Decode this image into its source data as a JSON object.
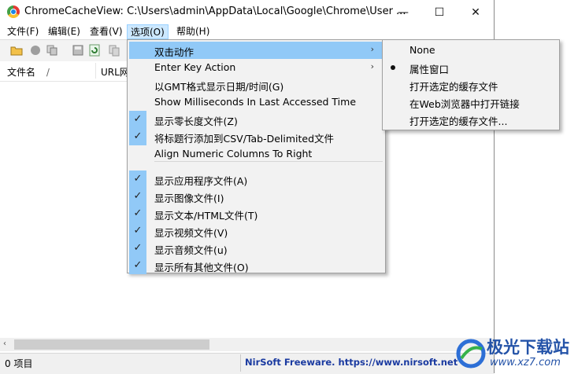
{
  "window": {
    "title": "ChromeCacheView:  C:\\Users\\admin\\AppData\\Local\\Google\\Chrome\\User ...",
    "controls": {
      "minimize": "—",
      "maximize": "☐",
      "close": "✕"
    }
  },
  "menubar": {
    "items": [
      "文件(F)",
      "编辑(E)",
      "查看(V)",
      "选项(O)",
      "帮助(H)"
    ],
    "active_index": 3
  },
  "columns": {
    "filename": "文件名",
    "sort_indicator": "/",
    "url": "URL网"
  },
  "options_menu": {
    "items": [
      {
        "label": "双击动作",
        "checked": false,
        "submenu": true,
        "highlighted": true
      },
      {
        "label": "Enter Key Action",
        "checked": false,
        "submenu": true
      },
      {
        "label": "以GMT格式显示日期/时间(G)",
        "checked": false
      },
      {
        "label": "Show Milliseconds In Last Accessed Time",
        "checked": false
      },
      {
        "label": "显示零长度文件(Z)",
        "checked": true
      },
      {
        "label": "将标题行添加到CSV/Tab-Delimited文件",
        "checked": true
      },
      {
        "label": "Align Numeric Columns To Right",
        "checked": false
      },
      {
        "label": "显示应用程序文件(A)",
        "checked": true
      },
      {
        "label": "显示图像文件(I)",
        "checked": true
      },
      {
        "label": "显示文本/HTML文件(T)",
        "checked": true
      },
      {
        "label": "显示视频文件(V)",
        "checked": true
      },
      {
        "label": "显示音频文件(u)",
        "checked": true
      },
      {
        "label": "显示所有其他文件(O)",
        "checked": true
      }
    ],
    "check_glyph": "✓",
    "arrow_glyph": "›"
  },
  "double_click_submenu": {
    "items": [
      {
        "label": "None",
        "selected": false
      },
      {
        "label": "属性窗口",
        "selected": true
      },
      {
        "label": "打开选定的缓存文件",
        "selected": false
      },
      {
        "label": "在Web浏览器中打开链接",
        "selected": false
      },
      {
        "label": "打开选定的缓存文件...",
        "selected": false
      }
    ]
  },
  "statusbar": {
    "items_count": "0 项目",
    "credit": "NirSoft Freeware. https://www.nirsoft.net"
  },
  "watermark": {
    "brand": "极光下载站",
    "url": "www.xz7.com"
  },
  "colors": {
    "highlight": "#91c9f7",
    "link": "#1a3aa0",
    "menu_active": "#cce8ff"
  }
}
